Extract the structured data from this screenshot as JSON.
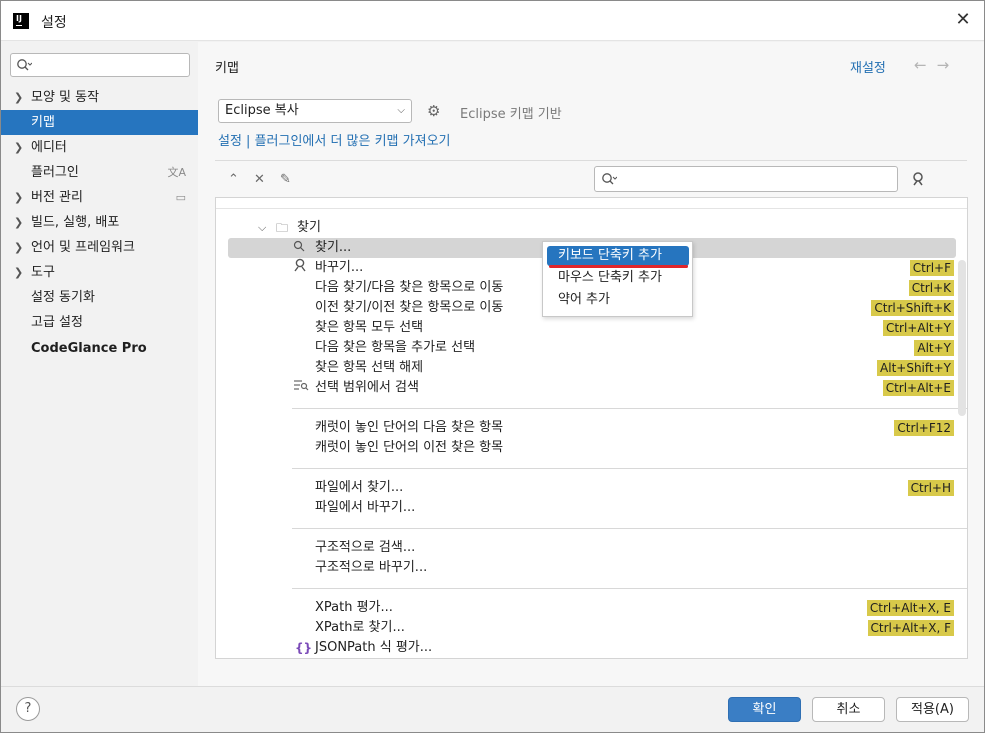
{
  "window": {
    "title": "설정",
    "app_icon": "IJ"
  },
  "sidebar": {
    "search_placeholder": "",
    "items": [
      {
        "label": "모양 및 동작",
        "expandable": true
      },
      {
        "label": "키맵",
        "selected": true
      },
      {
        "label": "에디터",
        "expandable": true
      },
      {
        "label": "플러그인"
      },
      {
        "label": "버전 관리",
        "expandable": true
      },
      {
        "label": "빌드, 실행, 배포",
        "expandable": true
      },
      {
        "label": "언어 및 프레임워크",
        "expandable": true
      },
      {
        "label": "도구",
        "expandable": true
      },
      {
        "label": "설정 동기화"
      },
      {
        "label": "고급 설정"
      },
      {
        "label": "CodeGlance Pro",
        "bold": true
      }
    ]
  },
  "main": {
    "title": "키맵",
    "reset_label": "재설정",
    "keymap_selected": "Eclipse 복사",
    "based_on": "Eclipse 키맵 기반",
    "more_keymaps_link": "설정 | 플러그인에서 더 많은 키맵 가져오기",
    "search_value": ""
  },
  "tree": {
    "group_label": "찾기",
    "rows": [
      {
        "label": "찾기...",
        "shortcut": "",
        "icon": "search-icon"
      },
      {
        "label": "바꾸기...",
        "shortcut": "Ctrl+F",
        "icon": "replace-icon"
      },
      {
        "label": "다음 찾기/다음 찾은 항목으로 이동",
        "shortcut": "Ctrl+K"
      },
      {
        "label": "이전 찾기/이전 찾은 항목으로 이동",
        "shortcut": "Ctrl+Shift+K"
      },
      {
        "label": "찾은 항목 모두 선택",
        "shortcut": "Ctrl+Alt+Y"
      },
      {
        "label": "다음 찾은 항목을 추가로 선택",
        "shortcut": "Alt+Y"
      },
      {
        "label": "찾은 항목 선택 해제",
        "shortcut": "Alt+Shift+Y"
      },
      {
        "label": "선택 범위에서 검색",
        "shortcut": "Ctrl+Alt+E",
        "icon": "search-in-selection-icon"
      },
      {
        "label": "캐럿이 놓인 단어의 다음 찾은 항목",
        "shortcut": "Ctrl+F12"
      },
      {
        "label": "캐럿이 놓인 단어의 이전 찾은 항목",
        "shortcut": ""
      },
      {
        "label": "파일에서 찾기...",
        "shortcut": "Ctrl+H"
      },
      {
        "label": "파일에서 바꾸기...",
        "shortcut": ""
      },
      {
        "label": "구조적으로 검색...",
        "shortcut": ""
      },
      {
        "label": "구조적으로 바꾸기...",
        "shortcut": ""
      },
      {
        "label": "XPath 평가...",
        "shortcut": "Ctrl+Alt+X, E"
      },
      {
        "label": "XPath로 찾기...",
        "shortcut": "Ctrl+Alt+X, F"
      },
      {
        "label": "JSONPath 식 평가...",
        "shortcut": "",
        "icon": "json-braces-icon"
      }
    ]
  },
  "context_menu": {
    "items": [
      {
        "label": "키보드 단축키 추가",
        "active": true
      },
      {
        "label": "마우스 단축키 추가"
      },
      {
        "label": "약어 추가"
      }
    ]
  },
  "footer": {
    "help": "?",
    "ok": "확인",
    "cancel": "취소",
    "apply": "적용(A)"
  },
  "colors": {
    "accent": "#2675bf",
    "link": "#2470b3",
    "shortcut_badge": "#d8c94a",
    "annotation_underline": "#e0262b"
  }
}
